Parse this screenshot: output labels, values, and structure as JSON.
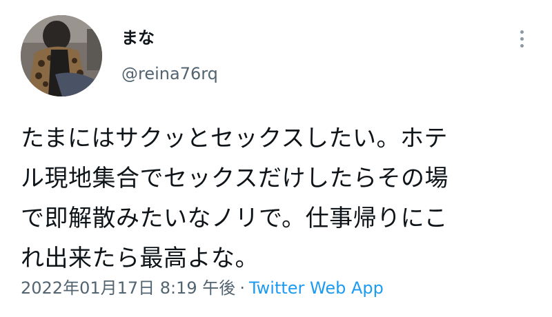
{
  "tweet": {
    "author": {
      "display_name": "まな",
      "handle": "@reina76rq"
    },
    "more_icon": "more-vertical-icon",
    "text_lines": [
      "たまにはサクッとセックスしたい。ホテ",
      "ル現地集合でセックスだけしたらその場",
      "で即解散みたいなノリで。仕事帰りにこ",
      "れ出来たら最高よな。"
    ],
    "timestamp": "2022年01月17日 8:19 午後",
    "separator": "·",
    "source": "Twitter Web App"
  },
  "colors": {
    "text": "#0f1419",
    "secondary": "#536471",
    "link": "#1d9bf0",
    "background": "#ffffff"
  }
}
